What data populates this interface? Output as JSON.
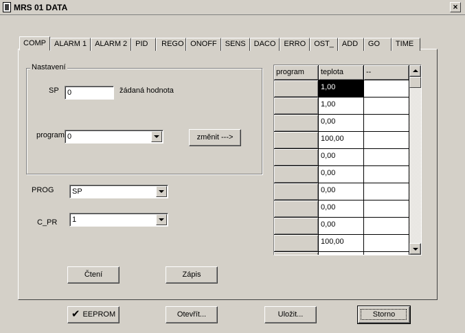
{
  "window": {
    "title": "MRS 01 DATA",
    "close_label": "×"
  },
  "tabs": [
    {
      "label": "COMP",
      "active": true
    },
    {
      "label": "ALARM 1"
    },
    {
      "label": "ALARM 2"
    },
    {
      "label": "PID"
    },
    {
      "label": "REGO"
    },
    {
      "label": "ONOFF"
    },
    {
      "label": "SENS"
    },
    {
      "label": "DACO"
    },
    {
      "label": "ERRO"
    },
    {
      "label": "OST_"
    },
    {
      "label": "ADD"
    },
    {
      "label": "GO"
    },
    {
      "label": "TIME"
    }
  ],
  "nastaveni": {
    "group_label": "Nastavení",
    "sp_label": "SP",
    "sp_value": "0",
    "sp_hint": "žádaná hodnota",
    "program_label": "program",
    "program_value": "0",
    "change_button": "změnit --->"
  },
  "prog": {
    "label": "PROG",
    "value": "SP"
  },
  "c_pr": {
    "label": "C_PR",
    "value": "1"
  },
  "grid": {
    "headers": [
      "program",
      "teplota",
      "--"
    ],
    "rows": [
      {
        "program": "",
        "teplota": "1,00",
        "extra": ""
      },
      {
        "program": "",
        "teplota": "1,00",
        "extra": ""
      },
      {
        "program": "",
        "teplota": "0,00",
        "extra": ""
      },
      {
        "program": "",
        "teplota": "100,00",
        "extra": ""
      },
      {
        "program": "",
        "teplota": "0,00",
        "extra": ""
      },
      {
        "program": "",
        "teplota": "0,00",
        "extra": ""
      },
      {
        "program": "",
        "teplota": "0,00",
        "extra": ""
      },
      {
        "program": "",
        "teplota": "0,00",
        "extra": ""
      },
      {
        "program": "",
        "teplota": "0,00",
        "extra": ""
      },
      {
        "program": "",
        "teplota": "100,00",
        "extra": ""
      },
      {
        "program": "",
        "teplota": "",
        "extra": ""
      }
    ]
  },
  "panel_buttons": {
    "read": "Čtení",
    "write": "Zápis"
  },
  "footer": {
    "eeprom": "EEPROM",
    "open": "Otevřít...",
    "save": "Uložit...",
    "cancel": "Storno"
  }
}
